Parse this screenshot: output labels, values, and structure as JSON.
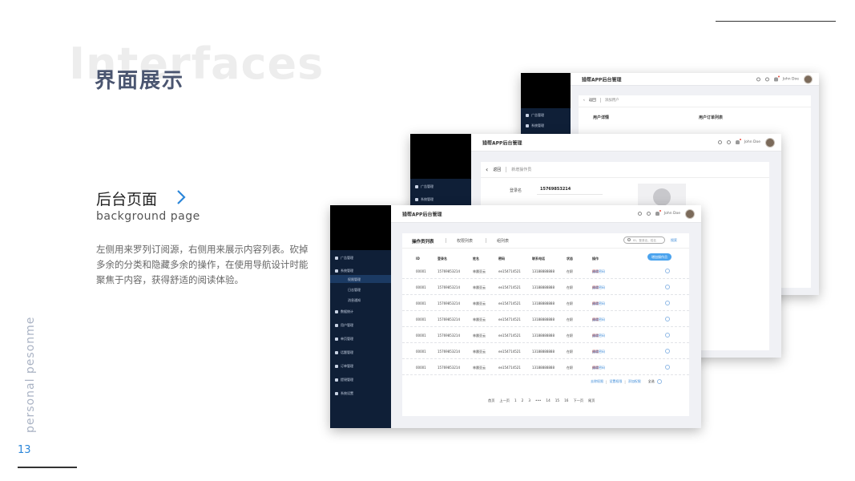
{
  "slide": {
    "bg_word": "Interfaces",
    "title": "界面展示",
    "subtitle_cn": "后台页面",
    "subtitle_en": "background page",
    "description": "左侧用来罗列订阅源，右侧用来展示内容列表。砍掉多余的分类和隐藏多余的操作，在使用导航设计时能聚焦于内容，获得舒适的阅读体验。",
    "side_text": "personal pesonme",
    "page_number": "13",
    "accent_color": "#2b86d9",
    "title_color": "#4a5570"
  },
  "app": {
    "name": "猎帮APP后台管理",
    "user": "John Doe"
  },
  "back_window": {
    "breadcrumb_back": "返回",
    "breadcrumb_current": "添加用户",
    "col_left": "用户详情",
    "col_right": "用户订单列表",
    "menu": [
      "广告管理",
      "系统管理"
    ]
  },
  "mid_window": {
    "breadcrumb_back": "返回",
    "breadcrumb_current": "新增操作员",
    "field_label": "登录名",
    "field_value": "15769853214",
    "menu": [
      "广告管理",
      "系统管理"
    ]
  },
  "front_window": {
    "tabs": [
      "操作员列表",
      "权限列表",
      "组列表"
    ],
    "search_placeholder": "ID、登录名、姓名",
    "search_button": "搜索",
    "add_button": "增加操作员",
    "columns": [
      "ID",
      "登录名",
      "姓名",
      "密码",
      "联系电话",
      "状态",
      "操作"
    ],
    "rows": [
      {
        "id": "00001",
        "login": "15769853214",
        "name": "林晨亚云",
        "pwd": "ee154714521",
        "phone": "13188888888",
        "status": "在职"
      },
      {
        "id": "00001",
        "login": "15769853214",
        "name": "林晨亚云",
        "pwd": "ee154714521",
        "phone": "13188888888",
        "status": "在职"
      },
      {
        "id": "00001",
        "login": "15769853214",
        "name": "林晨亚云",
        "pwd": "ee154714521",
        "phone": "13188888888",
        "status": "在职"
      },
      {
        "id": "00001",
        "login": "15769853214",
        "name": "林晨亚云",
        "pwd": "ee154714521",
        "phone": "13188888888",
        "status": "在职"
      },
      {
        "id": "00001",
        "login": "15769853214",
        "name": "林晨亚云",
        "pwd": "ee154714521",
        "phone": "13188888888",
        "status": "在职"
      },
      {
        "id": "00001",
        "login": "15769853214",
        "name": "林晨亚云",
        "pwd": "ee154714521",
        "phone": "13188888888",
        "status": "在职"
      },
      {
        "id": "00001",
        "login": "15769853214",
        "name": "林晨亚云",
        "pwd": "ee154714521",
        "phone": "13188888888",
        "status": "在职"
      }
    ],
    "row_ops": {
      "edit": "编辑",
      "modify_pwd": "修改密码",
      "disable": "停用"
    },
    "bulk_ops": {
      "remove": "去除权限",
      "set": "设置权限",
      "add": "添加权限",
      "select_all": "全选"
    },
    "pagination": [
      "首页",
      "上一页",
      "1",
      "2",
      "3",
      "•••",
      "14",
      "15",
      "16",
      "下一页",
      "尾页"
    ],
    "menu": [
      "广告管理",
      "系统管理",
      "权限管理",
      "日志管理",
      "消息通知",
      "数据统计",
      "用户管理",
      "单页管理",
      "话题管理",
      "订单管理",
      "提現管理",
      "系统设置"
    ]
  }
}
